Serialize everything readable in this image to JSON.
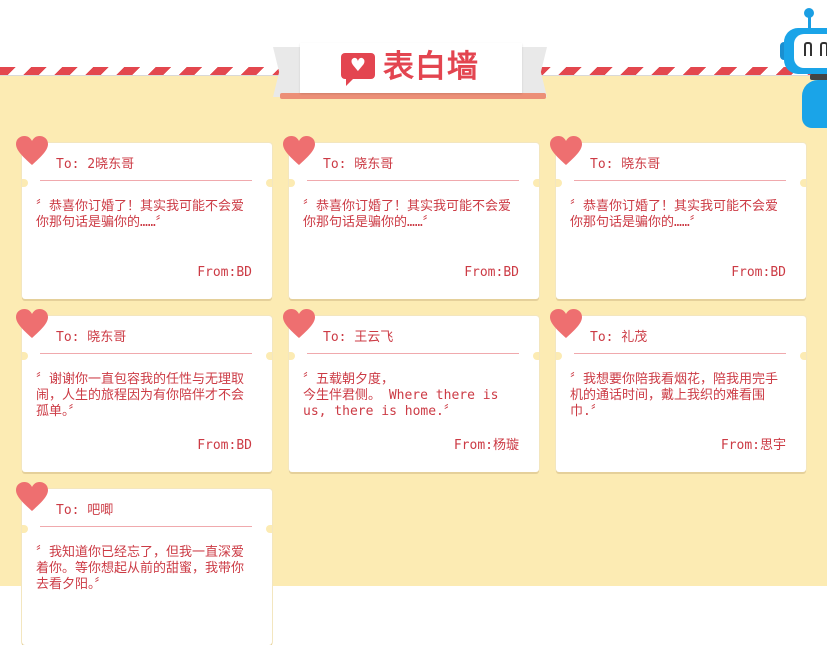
{
  "page": {
    "title": "表白墙",
    "title_icon": "heart-chat-icon"
  },
  "colors": {
    "accent": "#e34550",
    "wall": "#fcebb3",
    "heart": "#ee6f70",
    "text": "#cc3b45"
  },
  "cards": [
    {
      "to": "To: 2晓东哥",
      "message": "〞恭喜你订婚了！其实我可能不会爱你那句话是骗你的……〞",
      "from": "From:BD"
    },
    {
      "to": "To: 晓东哥",
      "message": "〞恭喜你订婚了！其实我可能不会爱你那句话是骗你的……〞",
      "from": "From:BD"
    },
    {
      "to": "To: 晓东哥",
      "message": "〞恭喜你订婚了！其实我可能不会爱你那句话是骗你的……〞",
      "from": "From:BD"
    },
    {
      "to": "To: 晓东哥",
      "message": "〞谢谢你一直包容我的任性与无理取闹，人生的旅程因为有你陪伴才不会孤单。〞",
      "from": "From:BD"
    },
    {
      "to": "To: 王云飞",
      "message": "〞五载朝夕度，\n今生伴君侧。 Where there is us, there is home.〞",
      "from": "From:杨璇"
    },
    {
      "to": "To: 礼茂",
      "message": "〞我想要你陪我看烟花，陪我用完手机的通话时间，戴上我织的难看围巾.〞",
      "from": "From:思宇"
    },
    {
      "to": "To: 吧唧",
      "message": "〞我知道你已经忘了，但我一直深爱着你。等你想起从前的甜蜜，我带你去看夕阳。〞",
      "from": ""
    }
  ]
}
